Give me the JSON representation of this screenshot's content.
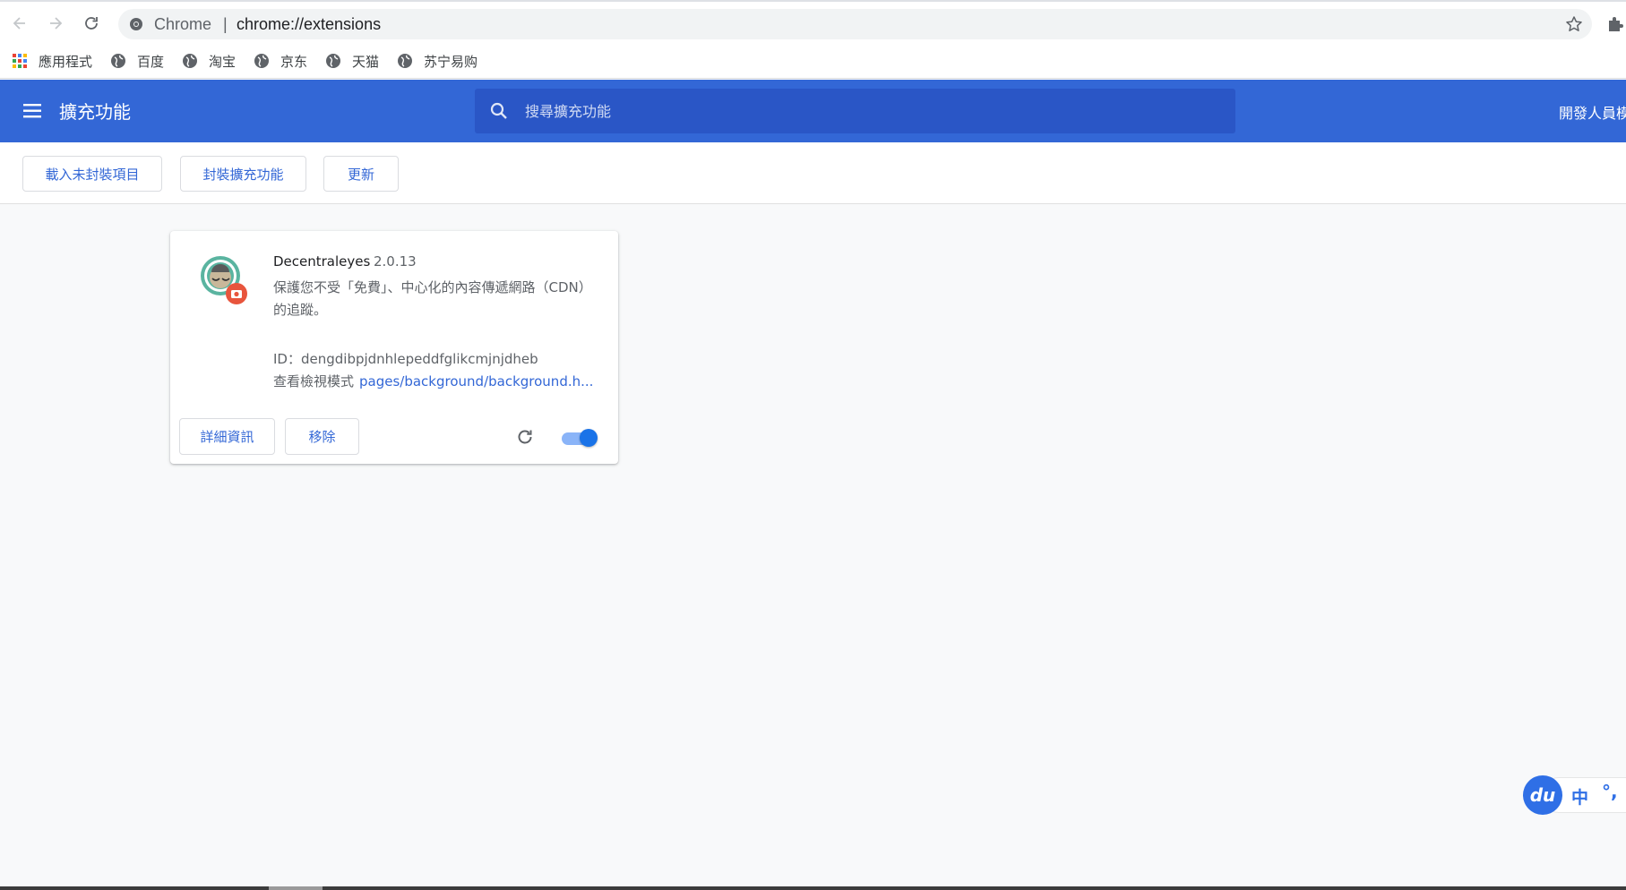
{
  "browser": {
    "site_name": "Chrome",
    "separator": "|",
    "url": "chrome://extensions"
  },
  "bookmarks": [
    {
      "label": "應用程式",
      "icon": "apps-grid-icon"
    },
    {
      "label": "百度",
      "icon": "globe-icon"
    },
    {
      "label": "淘宝",
      "icon": "globe-icon"
    },
    {
      "label": "京东",
      "icon": "globe-icon"
    },
    {
      "label": "天猫",
      "icon": "globe-icon"
    },
    {
      "label": "苏宁易购",
      "icon": "globe-icon"
    }
  ],
  "header": {
    "title": "擴充功能",
    "search_placeholder": "搜尋擴充功能",
    "dev_mode_label": "開發人員模"
  },
  "toolbar": {
    "load_unpacked": "載入未封裝項目",
    "pack_extension": "封裝擴充功能",
    "update": "更新"
  },
  "extension": {
    "name": "Decentraleyes",
    "version": "2.0.13",
    "description": "保護您不受「免費」、中心化的內容傳遞網路（CDN）的追蹤。",
    "id_text": "ID：dengdibpjdnhlepeddfglikcmjnjdheb",
    "views_label": "查看檢視模式",
    "views_link": "pages/background/background.h...",
    "details_label": "詳細資訊",
    "remove_label": "移除",
    "enabled": true
  },
  "ime": {
    "logo": "du",
    "mode": "中",
    "punct": "°,"
  },
  "colors": {
    "header_blue": "#3367d6",
    "search_blue": "#2a56c6",
    "link_blue": "#3367d6",
    "toggle_on": "#1a73e8"
  }
}
